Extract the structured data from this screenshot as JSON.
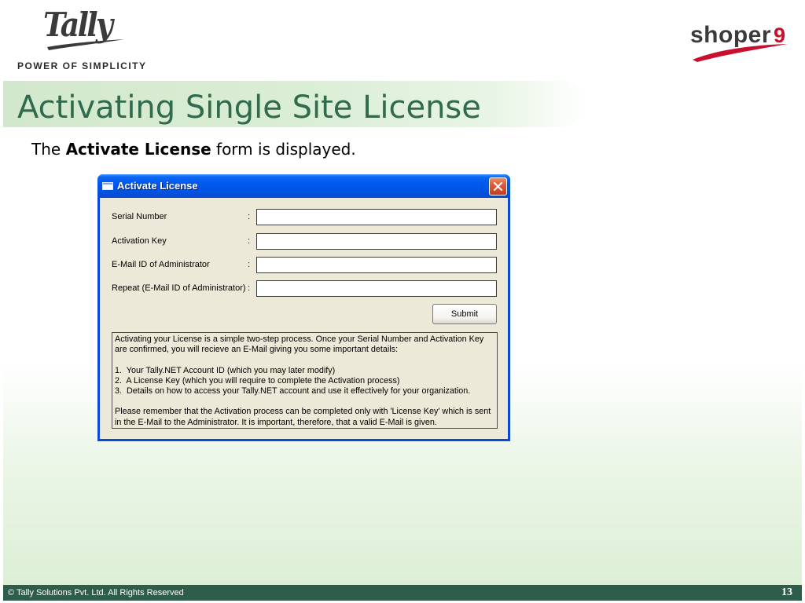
{
  "header": {
    "brand_logo_text": "Tally",
    "tagline": "POWER OF SIMPLICITY",
    "product_logo": {
      "name": "shoper",
      "version": "9"
    }
  },
  "slide": {
    "title": "Activating Single Site License",
    "intro": {
      "prefix": "The ",
      "emphasis": "Activate License",
      "suffix": " form is displayed."
    }
  },
  "dialog": {
    "title": "Activate License",
    "title_icon": "window-icon",
    "close_icon": "close-icon",
    "separator": ":",
    "fields": [
      {
        "label": "Serial Number",
        "value": ""
      },
      {
        "label": "Activation Key",
        "value": ""
      },
      {
        "label": "E-Mail ID of Administrator",
        "value": ""
      },
      {
        "label": "Repeat (E-Mail ID of Administrator)",
        "value": ""
      }
    ],
    "submit_label": "Submit",
    "info": {
      "paragraphs": [
        {
          "lines": [
            "Activating your License is a simple two-step process. Once your Serial Number and Activation Key",
            "are confirmed, you will recieve an E-Mail giving you some important details:"
          ]
        },
        {
          "lines": [
            "1.  Your Tally.NET Account ID (which you may later modify)",
            "2.  A License Key (which you will require to complete the Activation process)",
            "3.  Details on how to access your Tally.NET account and use it effectively for your organization."
          ]
        },
        {
          "lines": [
            "Please remember that the Activation process can be completed only with 'License Key' which is sent",
            "in the E-Mail to the Administrator. It is important, therefore, that a valid E-Mail is given."
          ]
        }
      ]
    }
  },
  "footer": {
    "copyright": "© Tally Solutions Pvt. Ltd. All Rights Reserved",
    "page_number": "13"
  },
  "colors": {
    "title_green": "#2f6b4c",
    "footer_bg": "#2f5d4b",
    "brand_red": "#c8102e",
    "window_blue": "#0054e3",
    "dialog_bg": "#ece9d8"
  }
}
